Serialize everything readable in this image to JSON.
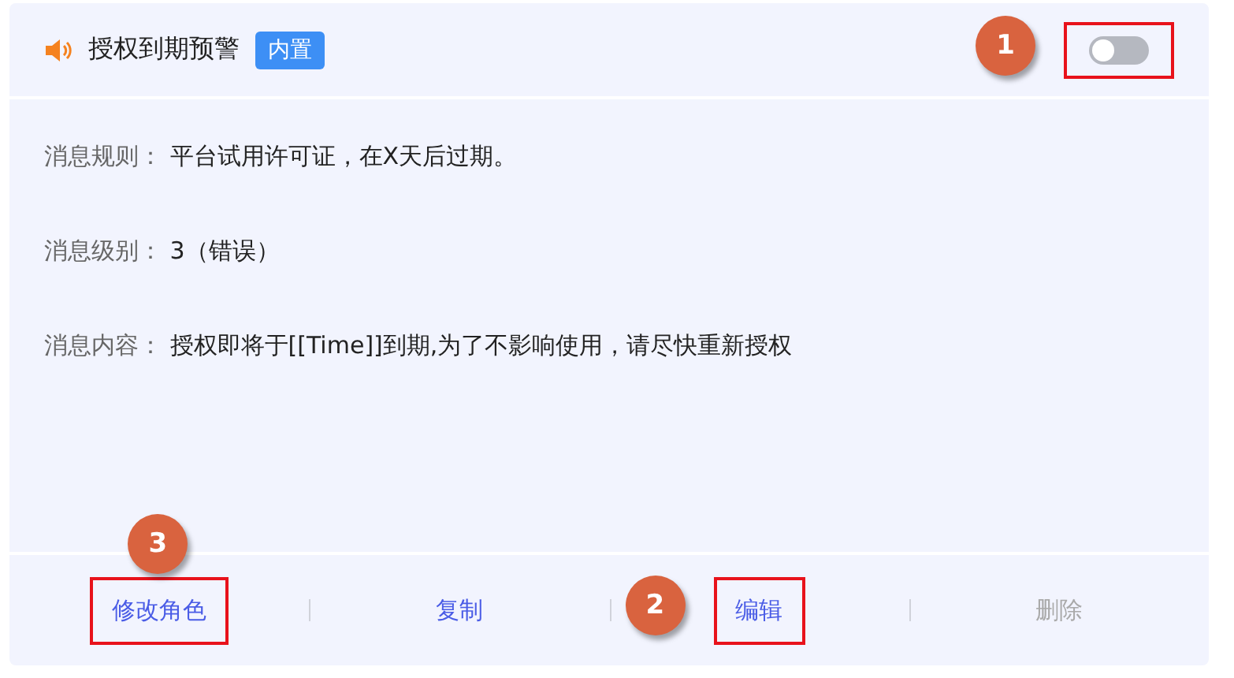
{
  "header": {
    "title": "授权到期预警",
    "tag": "内置",
    "toggle": {
      "on": false,
      "highlighted": true,
      "marker": "1",
      "marker_above": false
    }
  },
  "fields": [
    {
      "label": "消息规则：",
      "value": "平台试用许可证，在X天后过期。"
    },
    {
      "label": "消息级别：",
      "value": "3（错误）"
    },
    {
      "label": "消息内容：",
      "value": "授权即将于[[Time]]到期,为了不影响使用，请尽快重新授权"
    }
  ],
  "actions": [
    {
      "label": "修改角色",
      "disabled": false,
      "highlighted": true,
      "marker": "3",
      "marker_above": true
    },
    {
      "label": "复制",
      "disabled": false,
      "highlighted": false
    },
    {
      "label": "编辑",
      "disabled": false,
      "highlighted": true,
      "marker": "2",
      "marker_above": false
    },
    {
      "label": "删除",
      "disabled": true,
      "highlighted": false
    }
  ]
}
